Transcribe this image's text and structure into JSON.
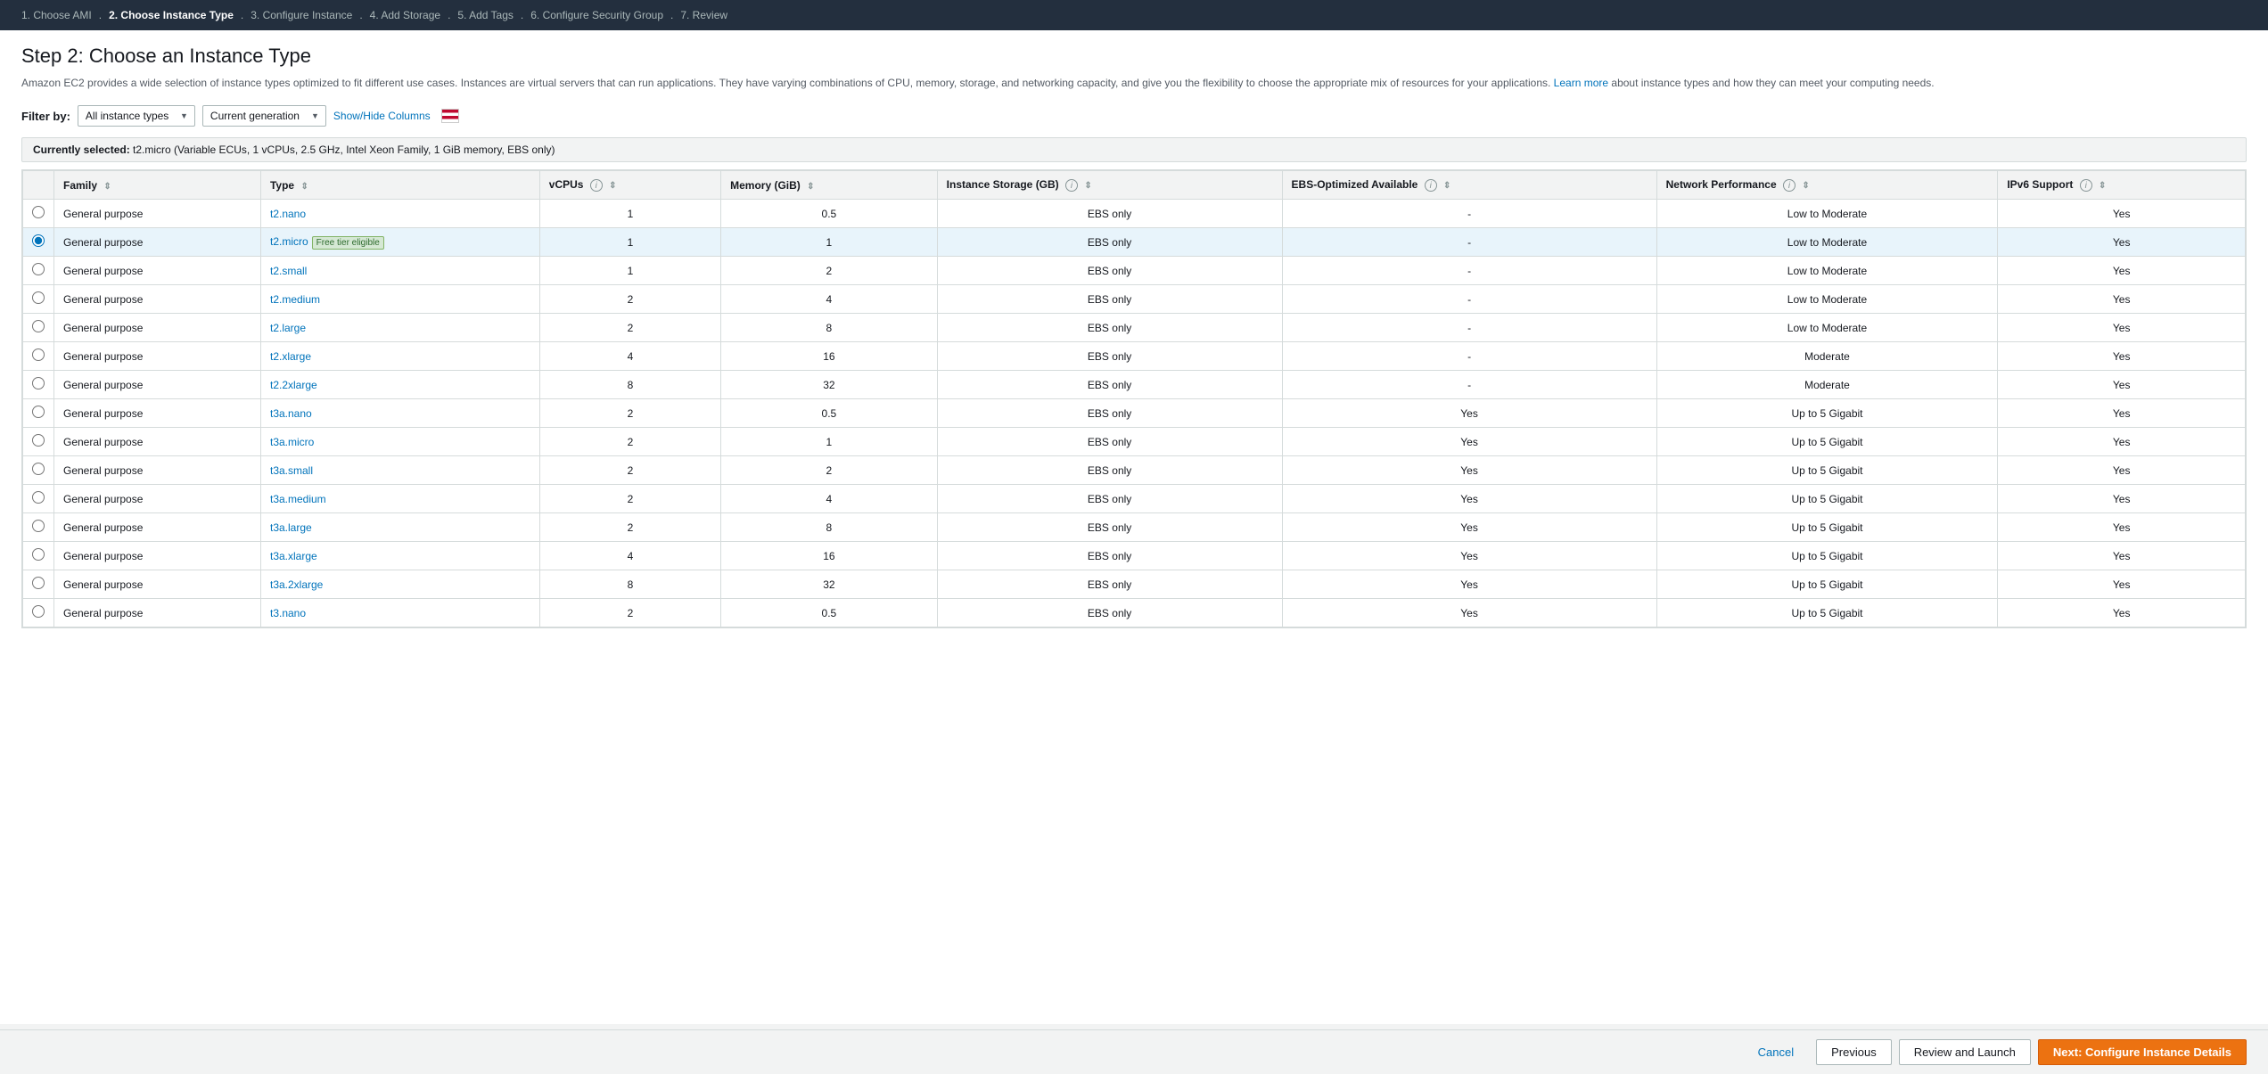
{
  "nav": {
    "steps": [
      {
        "id": "step1",
        "label": "1. Choose AMI",
        "active": false
      },
      {
        "id": "step2",
        "label": "2. Choose Instance Type",
        "active": true
      },
      {
        "id": "step3",
        "label": "3. Configure Instance",
        "active": false
      },
      {
        "id": "step4",
        "label": "4. Add Storage",
        "active": false
      },
      {
        "id": "step5",
        "label": "5. Add Tags",
        "active": false
      },
      {
        "id": "step6",
        "label": "6. Configure Security Group",
        "active": false
      },
      {
        "id": "step7",
        "label": "7. Review",
        "active": false
      }
    ]
  },
  "page": {
    "title": "Step 2: Choose an Instance Type",
    "description": "Amazon EC2 provides a wide selection of instance types optimized to fit different use cases. Instances are virtual servers that can run applications. They have varying combinations of CPU, memory, storage, and networking capacity, and give you the flexibility to choose the appropriate mix of resources for your applications.",
    "learn_more_link": "Learn more",
    "description_suffix": " about instance types and how they can meet your computing needs."
  },
  "filter": {
    "label": "Filter by:",
    "instance_types_label": "All instance types",
    "generation_label": "Current generation",
    "show_hide_label": "Show/Hide Columns"
  },
  "currently_selected": {
    "label": "Currently selected:",
    "value": "t2.micro (Variable ECUs, 1 vCPUs, 2.5 GHz, Intel Xeon Family, 1 GiB memory, EBS only)"
  },
  "table": {
    "headers": [
      {
        "id": "checkbox",
        "label": "",
        "info": false,
        "sort": false
      },
      {
        "id": "family",
        "label": "Family",
        "info": false,
        "sort": true
      },
      {
        "id": "type",
        "label": "Type",
        "info": false,
        "sort": true
      },
      {
        "id": "vcpus",
        "label": "vCPUs",
        "info": true,
        "sort": true
      },
      {
        "id": "memory",
        "label": "Memory (GiB)",
        "info": false,
        "sort": true
      },
      {
        "id": "instance_storage",
        "label": "Instance Storage (GB)",
        "info": true,
        "sort": true
      },
      {
        "id": "ebs_optimized",
        "label": "EBS-Optimized Available",
        "info": true,
        "sort": true
      },
      {
        "id": "network_performance",
        "label": "Network Performance",
        "info": true,
        "sort": true
      },
      {
        "id": "ipv6_support",
        "label": "IPv6 Support",
        "info": true,
        "sort": true
      }
    ],
    "rows": [
      {
        "selected": false,
        "family": "General purpose",
        "type": "t2.nano",
        "vcpus": "1",
        "memory": "0.5",
        "storage": "EBS only",
        "ebs_optimized": "-",
        "network": "Low to Moderate",
        "ipv6": "Yes",
        "free_tier": false
      },
      {
        "selected": true,
        "family": "General purpose",
        "type": "t2.micro",
        "vcpus": "1",
        "memory": "1",
        "storage": "EBS only",
        "ebs_optimized": "-",
        "network": "Low to Moderate",
        "ipv6": "Yes",
        "free_tier": true
      },
      {
        "selected": false,
        "family": "General purpose",
        "type": "t2.small",
        "vcpus": "1",
        "memory": "2",
        "storage": "EBS only",
        "ebs_optimized": "-",
        "network": "Low to Moderate",
        "ipv6": "Yes",
        "free_tier": false
      },
      {
        "selected": false,
        "family": "General purpose",
        "type": "t2.medium",
        "vcpus": "2",
        "memory": "4",
        "storage": "EBS only",
        "ebs_optimized": "-",
        "network": "Low to Moderate",
        "ipv6": "Yes",
        "free_tier": false
      },
      {
        "selected": false,
        "family": "General purpose",
        "type": "t2.large",
        "vcpus": "2",
        "memory": "8",
        "storage": "EBS only",
        "ebs_optimized": "-",
        "network": "Low to Moderate",
        "ipv6": "Yes",
        "free_tier": false
      },
      {
        "selected": false,
        "family": "General purpose",
        "type": "t2.xlarge",
        "vcpus": "4",
        "memory": "16",
        "storage": "EBS only",
        "ebs_optimized": "-",
        "network": "Moderate",
        "ipv6": "Yes",
        "free_tier": false
      },
      {
        "selected": false,
        "family": "General purpose",
        "type": "t2.2xlarge",
        "vcpus": "8",
        "memory": "32",
        "storage": "EBS only",
        "ebs_optimized": "-",
        "network": "Moderate",
        "ipv6": "Yes",
        "free_tier": false
      },
      {
        "selected": false,
        "family": "General purpose",
        "type": "t3a.nano",
        "vcpus": "2",
        "memory": "0.5",
        "storage": "EBS only",
        "ebs_optimized": "Yes",
        "network": "Up to 5 Gigabit",
        "ipv6": "Yes",
        "free_tier": false
      },
      {
        "selected": false,
        "family": "General purpose",
        "type": "t3a.micro",
        "vcpus": "2",
        "memory": "1",
        "storage": "EBS only",
        "ebs_optimized": "Yes",
        "network": "Up to 5 Gigabit",
        "ipv6": "Yes",
        "free_tier": false
      },
      {
        "selected": false,
        "family": "General purpose",
        "type": "t3a.small",
        "vcpus": "2",
        "memory": "2",
        "storage": "EBS only",
        "ebs_optimized": "Yes",
        "network": "Up to 5 Gigabit",
        "ipv6": "Yes",
        "free_tier": false
      },
      {
        "selected": false,
        "family": "General purpose",
        "type": "t3a.medium",
        "vcpus": "2",
        "memory": "4",
        "storage": "EBS only",
        "ebs_optimized": "Yes",
        "network": "Up to 5 Gigabit",
        "ipv6": "Yes",
        "free_tier": false
      },
      {
        "selected": false,
        "family": "General purpose",
        "type": "t3a.large",
        "vcpus": "2",
        "memory": "8",
        "storage": "EBS only",
        "ebs_optimized": "Yes",
        "network": "Up to 5 Gigabit",
        "ipv6": "Yes",
        "free_tier": false
      },
      {
        "selected": false,
        "family": "General purpose",
        "type": "t3a.xlarge",
        "vcpus": "4",
        "memory": "16",
        "storage": "EBS only",
        "ebs_optimized": "Yes",
        "network": "Up to 5 Gigabit",
        "ipv6": "Yes",
        "free_tier": false
      },
      {
        "selected": false,
        "family": "General purpose",
        "type": "t3a.2xlarge",
        "vcpus": "8",
        "memory": "32",
        "storage": "EBS only",
        "ebs_optimized": "Yes",
        "network": "Up to 5 Gigabit",
        "ipv6": "Yes",
        "free_tier": false
      },
      {
        "selected": false,
        "family": "General purpose",
        "type": "t3.nano",
        "vcpus": "2",
        "memory": "0.5",
        "storage": "EBS only",
        "ebs_optimized": "Yes",
        "network": "Up to 5 Gigabit",
        "ipv6": "Yes",
        "free_tier": false
      }
    ]
  },
  "bottom_nav": {
    "cancel_label": "Cancel",
    "previous_label": "Previous",
    "review_label": "Review and Launch",
    "next_label": "Next: Configure Instance Details"
  }
}
